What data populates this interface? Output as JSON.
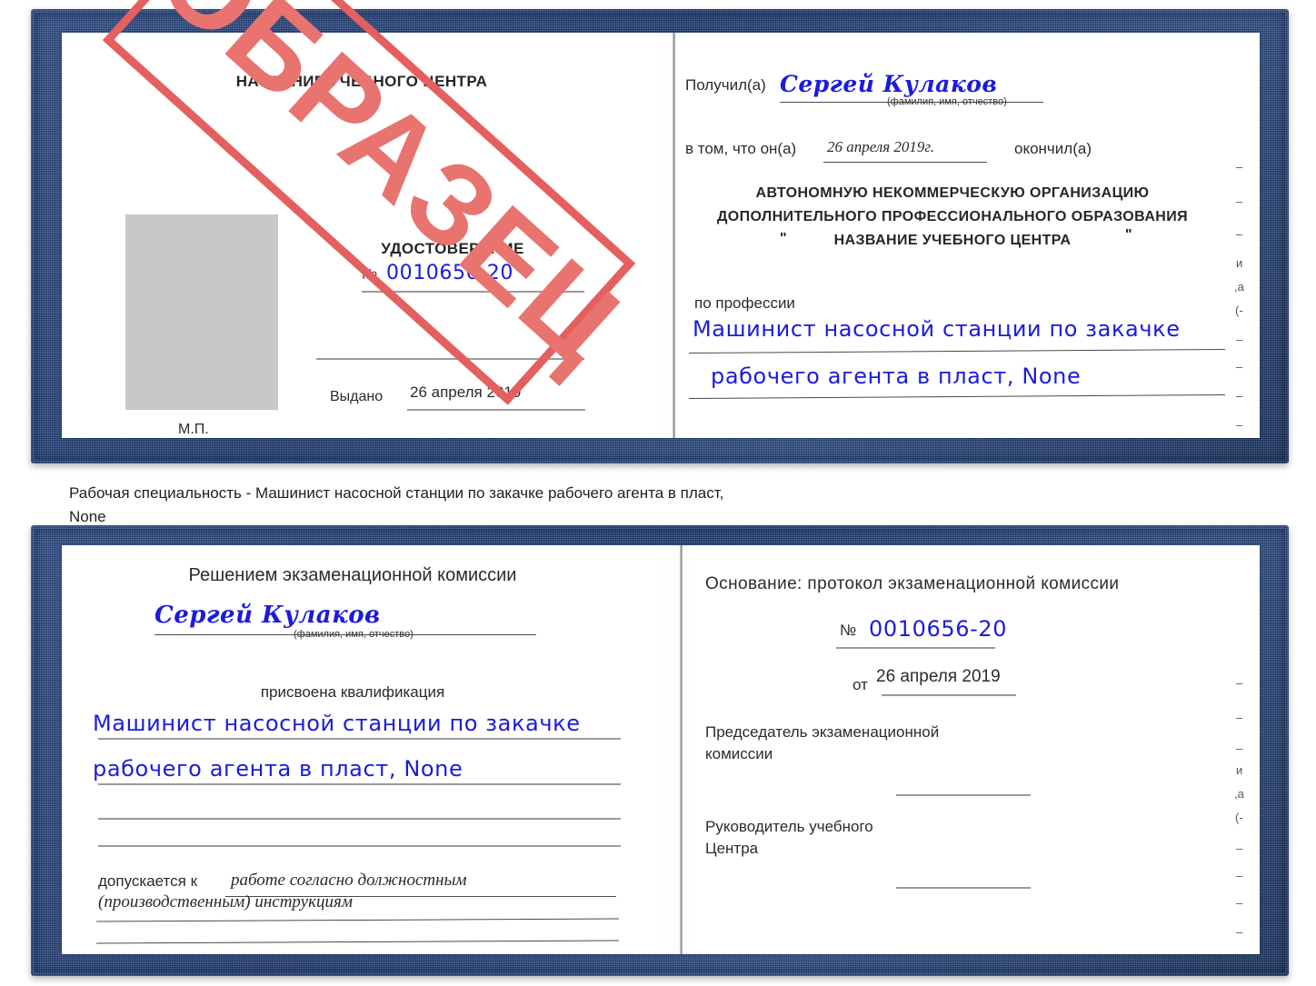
{
  "document": {
    "type": "certificate-pair",
    "colors": {
      "cover_blue": "#1d3a74",
      "handwriting_blue": "#1b1bdf",
      "stamp_red": "#e4605e",
      "photo_gray": "#c8c8c8",
      "rule_gray": "#9a9a9a"
    },
    "stamp": {
      "text": "ОБРАЗЕЦ",
      "rotation_deg": 42
    }
  },
  "certificate_top": {
    "left_page": {
      "org_header": "НАЗВАНИЕ УЧЕБНОГО ЦЕНТРА",
      "doc_title": "УДОСТОВЕРЕНИЕ",
      "number_symbol": "№",
      "number_value": "0010656-20",
      "issued_label": "Выдано",
      "issued_value": "26 апреля 2019",
      "seal_label": "М.П.",
      "photo_placeholder": ""
    },
    "right_page": {
      "received_label": "Получил(а)",
      "received_value": "Сергей Кулаков",
      "name_hint": "(фамилия, имя, отчество)",
      "that_he_label": "в том, что он(а)",
      "that_he_date": "26 апреля 2019г.",
      "finished_label": "окончил(а)",
      "org_line1": "АВТОНОМНУЮ НЕКОММЕРЧЕСКУЮ ОРГАНИЗАЦИЮ",
      "org_line2": "ДОПОЛНИТЕЛЬНОГО ПРОФЕССИОНАЛЬНОГО ОБРАЗОВАНИЯ",
      "org_quote_open": "\"",
      "org_line3": "НАЗВАНИЕ УЧЕБНОГО ЦЕНТРА",
      "org_quote_close": "\"",
      "profession_label": "по профессии",
      "profession_line1": "Машинист насосной станции по закачке",
      "profession_line2": "рабочего агента в пласт, None",
      "bleed_marks": [
        "–",
        "–",
        "–",
        "и",
        ",а",
        "(-",
        "–",
        "–",
        "–",
        "–"
      ]
    }
  },
  "caption": {
    "line1": "Рабочая специальность - Машинист насосной станции по закачке рабочего агента в пласт,",
    "line2": "None"
  },
  "certificate_bottom": {
    "left_page": {
      "heading": "Решением экзаменационной комиссии",
      "name_value": "Сергей Кулаков",
      "name_hint": "(фамилия, имя, отчество)",
      "qualification_label": "присвоена квалификация",
      "qualification_line1": "Машинист насосной станции по закачке",
      "qualification_line2": "рабочего агента в пласт, None",
      "allowed_label": "допускается к",
      "allowed_line1": "работе согласно должностным",
      "allowed_line2": "(производственным) инструкциям"
    },
    "right_page": {
      "basis_label": "Основание: протокол экзаменационной комиссии",
      "number_symbol": "№",
      "number_value": "0010656-20",
      "from_label": "от",
      "from_value": "26 апреля 2019",
      "chairman_line1": "Председатель экзаменационной",
      "chairman_line2": "комиссии",
      "head_line1": "Руководитель учебного",
      "head_line2": "Центра",
      "bleed_marks": [
        "–",
        "–",
        "–",
        "и",
        ",а",
        "(-",
        "–",
        "–",
        "–",
        "–"
      ]
    }
  }
}
